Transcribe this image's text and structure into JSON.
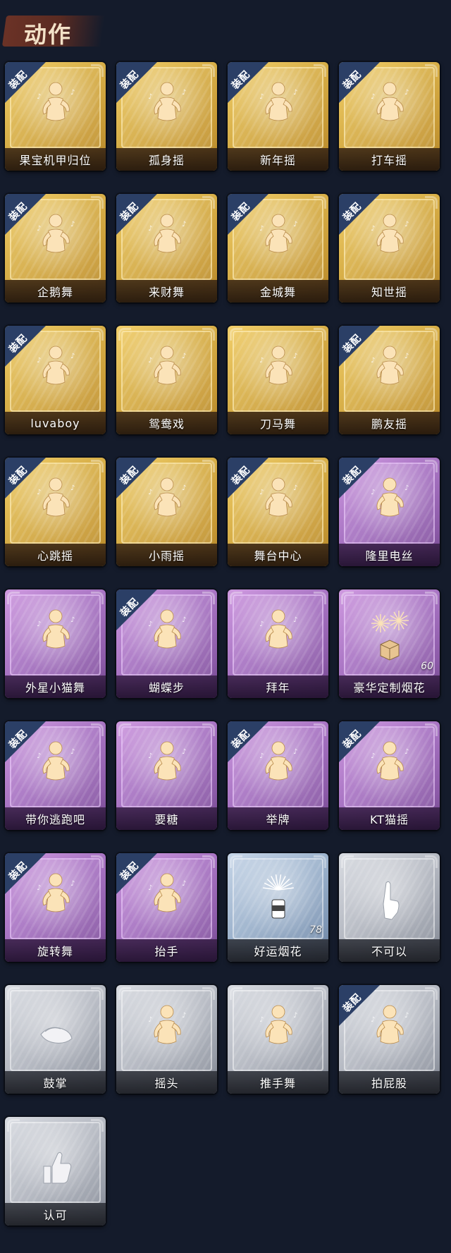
{
  "header": {
    "title": "动作"
  },
  "badge_text": "装配",
  "items": [
    {
      "label": "果宝机甲归位",
      "rarity": "gold",
      "equipped": true,
      "count": "",
      "icon": "dance-figure-icon"
    },
    {
      "label": "孤身摇",
      "rarity": "gold",
      "equipped": true,
      "count": "",
      "icon": "dance-figure-icon"
    },
    {
      "label": "新年摇",
      "rarity": "gold",
      "equipped": true,
      "count": "",
      "icon": "dance-figure-icon"
    },
    {
      "label": "打车摇",
      "rarity": "gold",
      "equipped": true,
      "count": "",
      "icon": "dance-figure-icon"
    },
    {
      "label": "企鹅舞",
      "rarity": "gold",
      "equipped": true,
      "count": "",
      "icon": "dance-figure-icon"
    },
    {
      "label": "来财舞",
      "rarity": "gold",
      "equipped": true,
      "count": "",
      "icon": "dance-figure-icon"
    },
    {
      "label": "金城舞",
      "rarity": "gold",
      "equipped": true,
      "count": "",
      "icon": "dance-figure-icon"
    },
    {
      "label": "知世摇",
      "rarity": "gold",
      "equipped": true,
      "count": "",
      "icon": "dance-figure-icon"
    },
    {
      "label": "luvaboy",
      "rarity": "gold",
      "equipped": true,
      "count": "",
      "icon": "dance-figure-icon"
    },
    {
      "label": "鸳鸯戏",
      "rarity": "gold",
      "equipped": false,
      "count": "",
      "icon": "dance-figure-icon"
    },
    {
      "label": "刀马舞",
      "rarity": "gold",
      "equipped": false,
      "count": "",
      "icon": "dance-figure-icon"
    },
    {
      "label": "鹏友摇",
      "rarity": "gold",
      "equipped": true,
      "count": "",
      "icon": "dance-figure-icon"
    },
    {
      "label": "心跳摇",
      "rarity": "gold",
      "equipped": true,
      "count": "",
      "icon": "dance-figure-icon"
    },
    {
      "label": "小雨摇",
      "rarity": "gold",
      "equipped": true,
      "count": "",
      "icon": "dance-figure-icon"
    },
    {
      "label": "舞台中心",
      "rarity": "gold",
      "equipped": true,
      "count": "",
      "icon": "dance-figure-icon"
    },
    {
      "label": "隆里电丝",
      "rarity": "purple",
      "equipped": true,
      "count": "",
      "icon": "dance-figure-icon"
    },
    {
      "label": "外星小猫舞",
      "rarity": "purple",
      "equipped": false,
      "count": "",
      "icon": "dance-figure-icon"
    },
    {
      "label": "蝴蝶步",
      "rarity": "purple",
      "equipped": true,
      "count": "",
      "icon": "dance-figure-icon"
    },
    {
      "label": "拜年",
      "rarity": "purple",
      "equipped": false,
      "count": "",
      "icon": "bow-figure-icon"
    },
    {
      "label": "豪华定制烟花",
      "rarity": "purple",
      "equipped": false,
      "count": "60",
      "icon": "fireworks-box-icon"
    },
    {
      "label": "带你逃跑吧",
      "rarity": "purple",
      "equipped": true,
      "count": "",
      "icon": "dance-figure-icon"
    },
    {
      "label": "要糖",
      "rarity": "purple",
      "equipped": false,
      "count": "",
      "icon": "ask-figure-icon"
    },
    {
      "label": "举牌",
      "rarity": "purple",
      "equipped": true,
      "count": "",
      "icon": "sign-figure-icon"
    },
    {
      "label": "KT猫摇",
      "rarity": "purple",
      "equipped": true,
      "count": "",
      "icon": "dance-figure-icon"
    },
    {
      "label": "旋转舞",
      "rarity": "purple",
      "equipped": true,
      "count": "",
      "icon": "spin-figure-icon"
    },
    {
      "label": "抬手",
      "rarity": "purple",
      "equipped": true,
      "count": "",
      "icon": "raise-hand-figure-icon"
    },
    {
      "label": "好运烟花",
      "rarity": "blue",
      "equipped": false,
      "count": "78",
      "icon": "firework-can-icon"
    },
    {
      "label": "不可以",
      "rarity": "silver",
      "equipped": false,
      "count": "",
      "icon": "finger-wag-icon"
    },
    {
      "label": "鼓掌",
      "rarity": "silver",
      "equipped": false,
      "count": "",
      "icon": "clap-hands-icon"
    },
    {
      "label": "摇头",
      "rarity": "silver",
      "equipped": false,
      "count": "",
      "icon": "head-shake-figure-icon"
    },
    {
      "label": "推手舞",
      "rarity": "silver",
      "equipped": false,
      "count": "",
      "icon": "push-hands-figure-icon"
    },
    {
      "label": "拍屁股",
      "rarity": "silver",
      "equipped": true,
      "count": "",
      "icon": "butt-slap-figure-icon"
    },
    {
      "label": "认可",
      "rarity": "silver",
      "equipped": false,
      "count": "",
      "icon": "thumbs-up-icon"
    }
  ],
  "colors": {
    "gold": "#d9b14a",
    "purple": "#a874c3",
    "silver": "#b6bac3",
    "blue": "#9db3cd",
    "badge": "#2b3f66",
    "background": "#141b2b"
  }
}
